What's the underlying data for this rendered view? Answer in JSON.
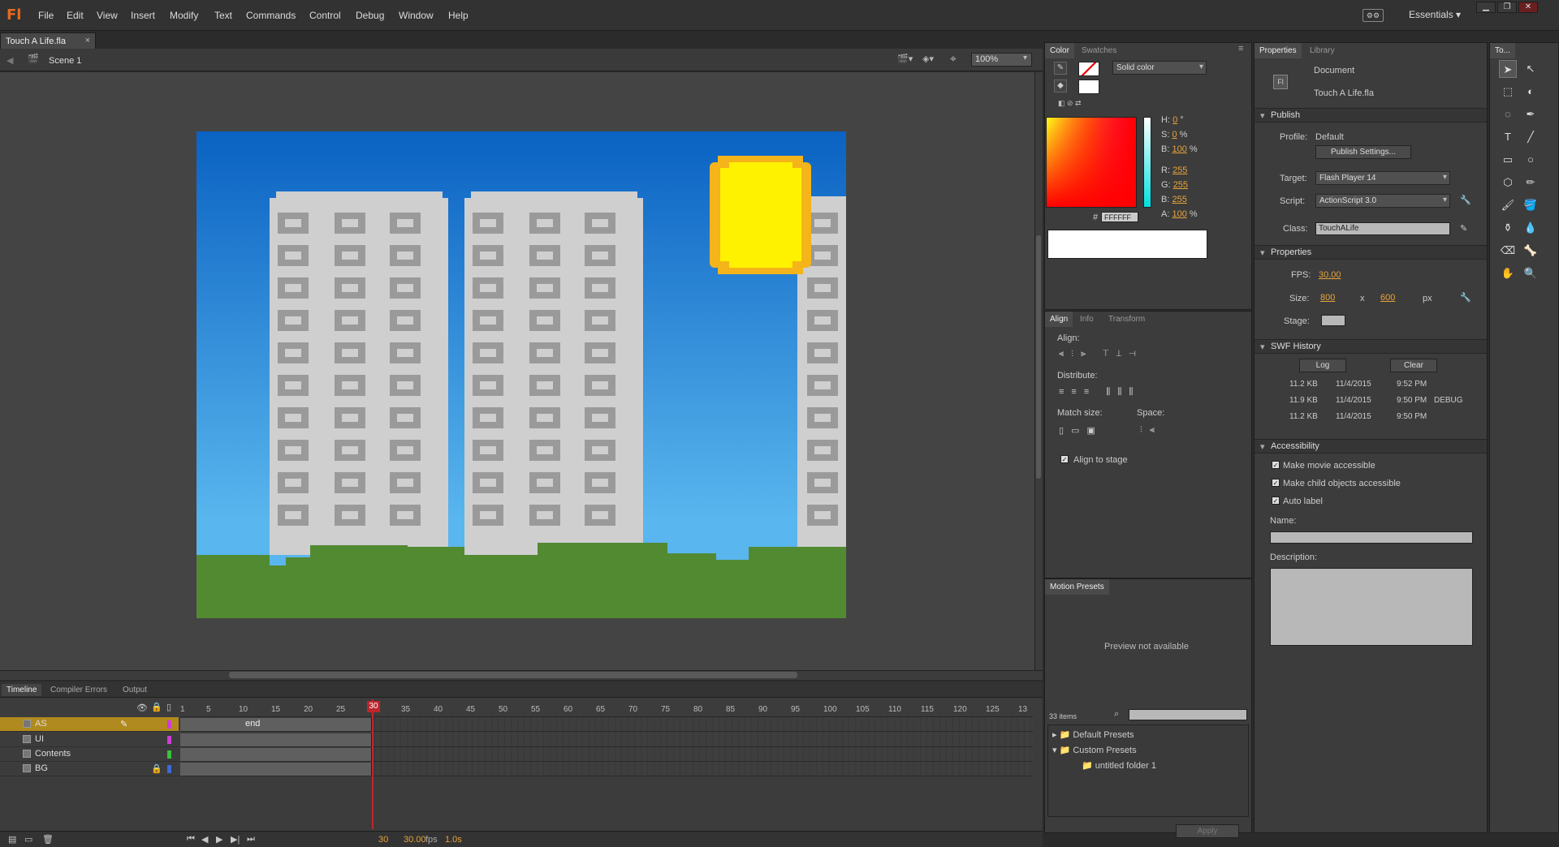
{
  "menubar": {
    "logo": "Fl",
    "items": [
      "File",
      "Edit",
      "View",
      "Insert",
      "Modify",
      "Text",
      "Commands",
      "Control",
      "Debug",
      "Window",
      "Help"
    ],
    "workspace": "Essentials",
    "ws_icon": "⚙⚙"
  },
  "document": {
    "tab": "Touch A Life.fla",
    "scene": "Scene 1",
    "zoom": "100%"
  },
  "timeline": {
    "tabs": [
      "Timeline",
      "Compiler Errors",
      "Output"
    ],
    "ticks": [
      "1",
      "5",
      "10",
      "15",
      "20",
      "25",
      "30",
      "35",
      "40",
      "45",
      "50",
      "55",
      "60",
      "65",
      "70",
      "75",
      "80",
      "85",
      "90",
      "95",
      "100",
      "105",
      "110",
      "115",
      "120",
      "125",
      "13"
    ],
    "layers": [
      {
        "name": "AS",
        "color": "#d13cd8",
        "frame_label": "end"
      },
      {
        "name": "UI",
        "color": "#d13cd8"
      },
      {
        "name": "Contents",
        "color": "#3ac23a"
      },
      {
        "name": "BG",
        "color": "#3a6bd6"
      }
    ],
    "current_frame": "30",
    "fps": "30.00",
    "fps_unit": "fps",
    "time": "1.0s"
  },
  "color": {
    "tabs": [
      "Color",
      "Swatches"
    ],
    "type": "Solid color",
    "h": "0",
    "h_unit": "°",
    "s": "0",
    "s_unit": "%",
    "b": "100",
    "b_unit": "%",
    "r": "255",
    "g": "255",
    "b2": "255",
    "a": "100",
    "a_unit": "%",
    "hex": "FFFFFF",
    "labels": {
      "h": "H:",
      "s": "S:",
      "b": "B:",
      "r": "R:",
      "g": "G:",
      "bb": "B:",
      "a": "A:",
      "hash": "#"
    }
  },
  "align": {
    "tabs": [
      "Align",
      "Info",
      "Transform"
    ],
    "align_label": "Align:",
    "distribute_label": "Distribute:",
    "match_label": "Match size:",
    "space_label": "Space:",
    "align_to_stage": "Align to stage"
  },
  "motion": {
    "tab": "Motion Presets",
    "preview": "Preview not available",
    "count": "33 items",
    "items": [
      "Default Presets",
      "Custom Presets",
      "untitled folder 1"
    ],
    "apply": "Apply"
  },
  "properties": {
    "tabs": [
      "Properties",
      "Library"
    ],
    "doc_label": "Document",
    "doc_name": "Touch A Life.fla",
    "publish": {
      "title": "Publish",
      "profile_label": "Profile:",
      "profile": "Default",
      "settings_btn": "Publish Settings...",
      "target_label": "Target:",
      "target": "Flash Player 14",
      "script_label": "Script:",
      "script": "ActionScript 3.0",
      "class_label": "Class:",
      "class": "TouchALife"
    },
    "props": {
      "title": "Properties",
      "fps_label": "FPS:",
      "fps": "30.00",
      "size_label": "Size:",
      "w": "800",
      "x": "x",
      "h": "600",
      "unit": "px",
      "stage_label": "Stage:"
    },
    "swf": {
      "title": "SWF History",
      "log": "Log",
      "clear": "Clear",
      "rows": [
        [
          "11.2 KB",
          "11/4/2015",
          "9:52 PM",
          ""
        ],
        [
          "11.9 KB",
          "11/4/2015",
          "9:50 PM",
          "DEBUG"
        ],
        [
          "11.2 KB",
          "11/4/2015",
          "9:50 PM",
          ""
        ]
      ]
    },
    "access": {
      "title": "Accessibility",
      "c1": "Make movie accessible",
      "c2": "Make child objects accessible",
      "c3": "Auto label",
      "name_label": "Name:",
      "desc_label": "Description:"
    }
  },
  "tools": {
    "tab": "To..."
  }
}
